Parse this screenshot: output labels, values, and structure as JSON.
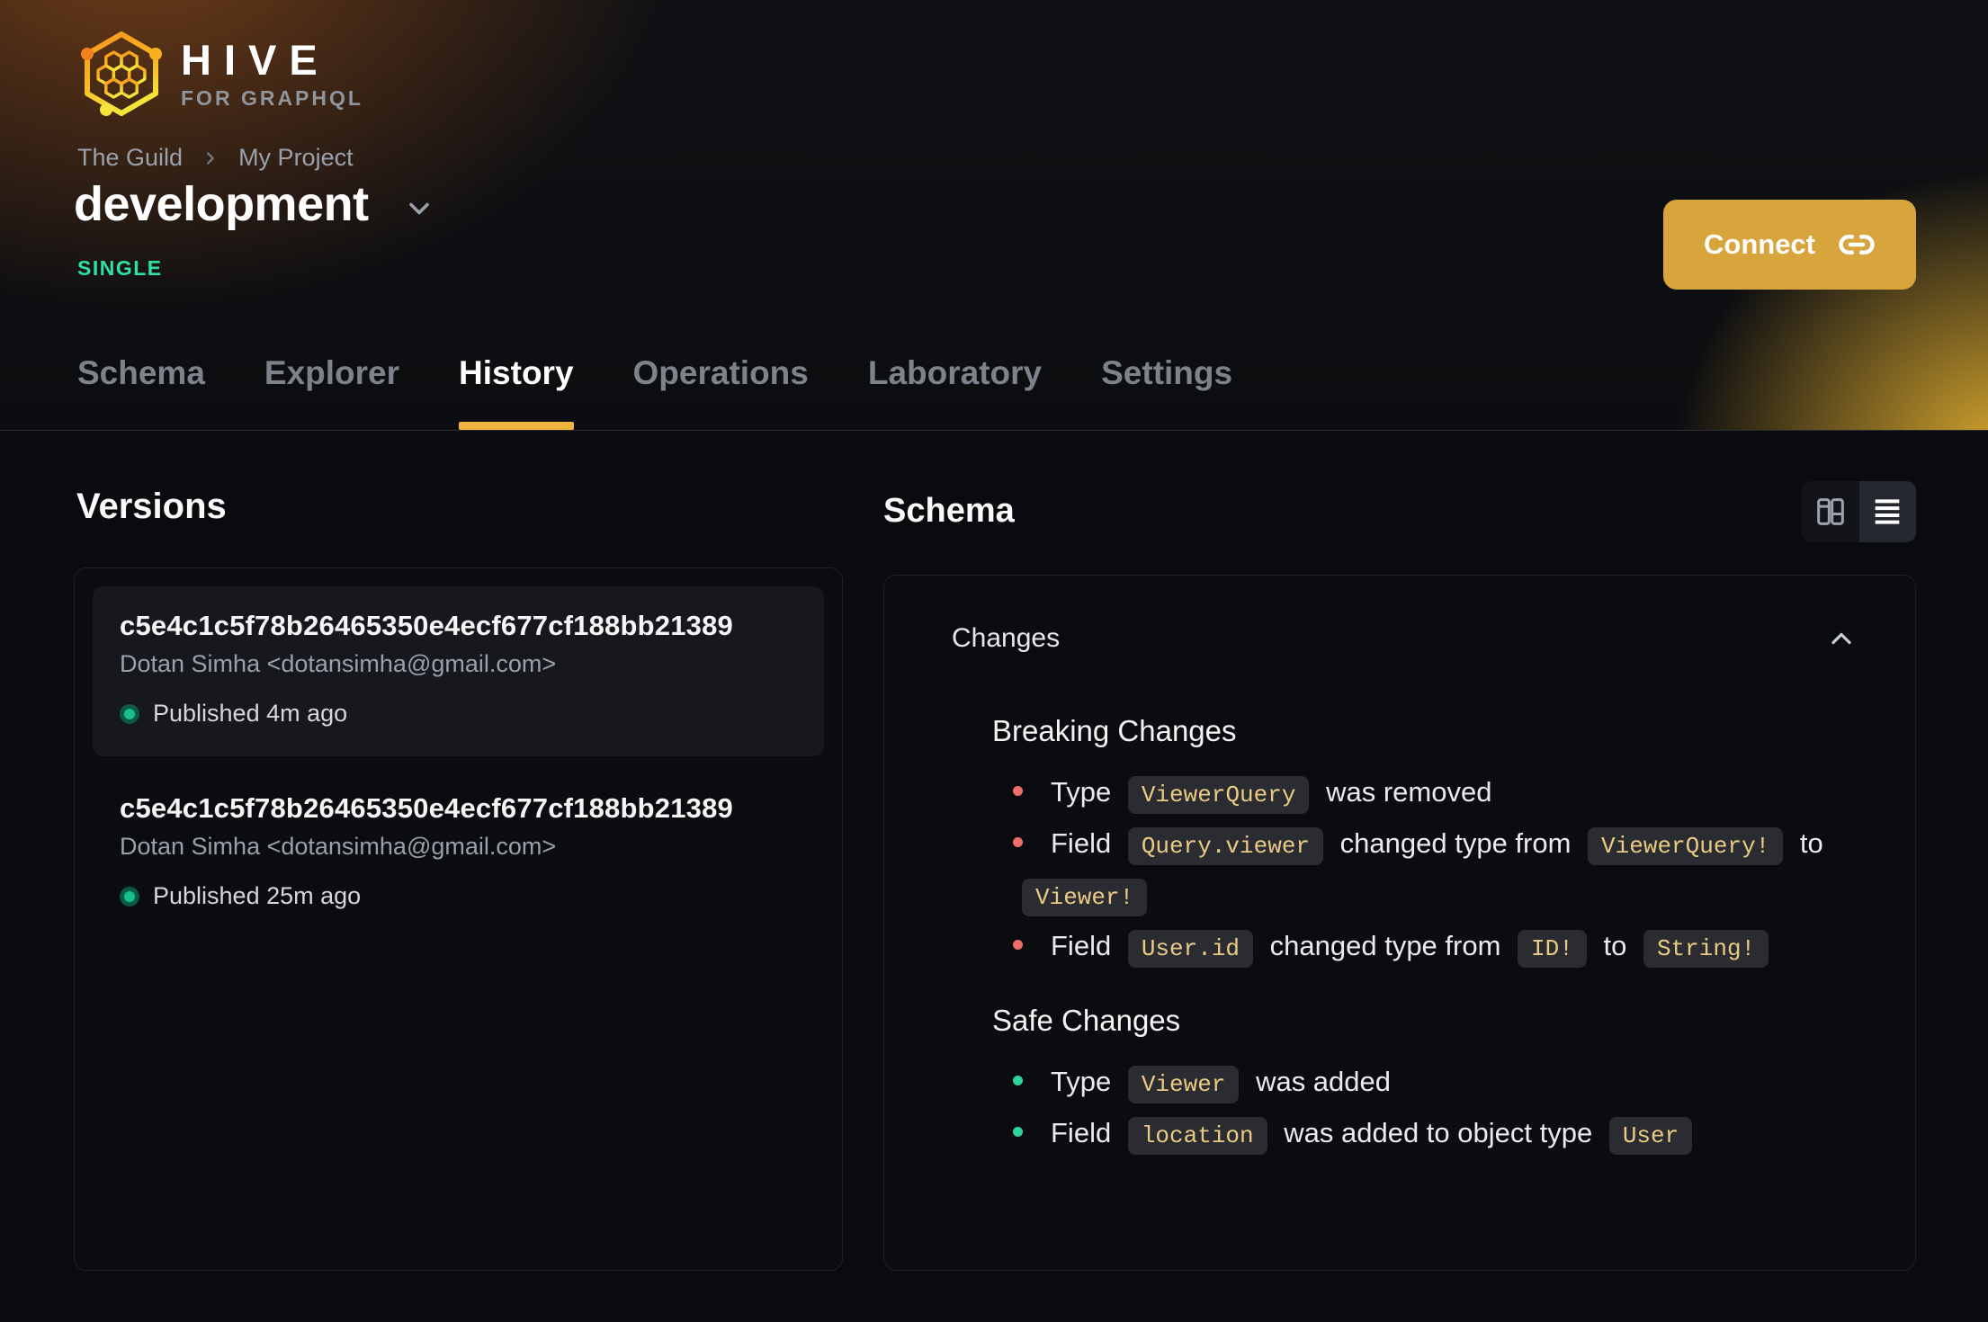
{
  "brand": {
    "name": "HIVE",
    "tagline": "FOR GRAPHQL"
  },
  "breadcrumb": {
    "items": [
      "The Guild",
      "My Project"
    ]
  },
  "project": {
    "title": "development",
    "badge": "SINGLE"
  },
  "header": {
    "connect_label": "Connect"
  },
  "tabs": [
    {
      "label": "Schema",
      "active": false
    },
    {
      "label": "Explorer",
      "active": false
    },
    {
      "label": "History",
      "active": true
    },
    {
      "label": "Operations",
      "active": false
    },
    {
      "label": "Laboratory",
      "active": false
    },
    {
      "label": "Settings",
      "active": false
    }
  ],
  "versions": {
    "heading": "Versions",
    "items": [
      {
        "hash": "c5e4c1c5f78b26465350e4ecf677cf188bb21389",
        "author": "Dotan Simha <dotansimha@gmail.com>",
        "status": "Published 4m ago",
        "selected": true
      },
      {
        "hash": "c5e4c1c5f78b26465350e4ecf677cf188bb21389",
        "author": "Dotan Simha <dotansimha@gmail.com>",
        "status": "Published 25m ago",
        "selected": false
      }
    ]
  },
  "schema_panel": {
    "heading": "Schema",
    "changes_title": "Changes",
    "view_toggle": {
      "options": [
        "columns-view",
        "list-view"
      ],
      "active": "list-view"
    },
    "sections": [
      {
        "title": "Breaking Changes",
        "bullet_color": "#ed6e66",
        "items": [
          [
            {
              "t": "Type "
            },
            {
              "c": "ViewerQuery"
            },
            {
              "t": " was removed"
            }
          ],
          [
            {
              "t": "Field "
            },
            {
              "c": "Query.viewer"
            },
            {
              "t": " changed type from "
            },
            {
              "c": "ViewerQuery!"
            },
            {
              "t": " to "
            },
            {
              "c": "Viewer!"
            }
          ],
          [
            {
              "t": "Field "
            },
            {
              "c": "User.id"
            },
            {
              "t": " changed type from "
            },
            {
              "c": "ID!"
            },
            {
              "t": " to "
            },
            {
              "c": "String!"
            }
          ]
        ]
      },
      {
        "title": "Safe Changes",
        "bullet_color": "#2fd49a",
        "items": [
          [
            {
              "t": "Type "
            },
            {
              "c": "Viewer"
            },
            {
              "t": " was added"
            }
          ],
          [
            {
              "t": "Field "
            },
            {
              "c": "location"
            },
            {
              "t": " was added to object type "
            },
            {
              "c": "User"
            }
          ]
        ]
      }
    ]
  },
  "colors": {
    "accent_yellow": "#f0b53e",
    "connect_button": "#d8a43c",
    "badge_green": "#2fe0a4",
    "published_dot": "#17c08a",
    "breaking_bullet": "#ed6e66",
    "safe_bullet": "#2fd49a",
    "chip_text": "#e9cb83",
    "chip_background": "#2b2c31",
    "header_glow_orange": "#b35c1a",
    "header_glow_yellow": "#e4b130"
  }
}
